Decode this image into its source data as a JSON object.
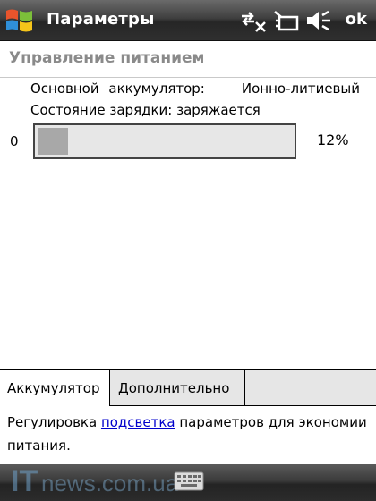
{
  "titlebar": {
    "title": "Параметры",
    "ok_label": "ok",
    "icons": [
      "windows-start-icon",
      "connectivity-icon",
      "charging-icon",
      "volume-icon"
    ]
  },
  "header": {
    "title": "Управление питанием"
  },
  "battery": {
    "main_label": "Основной аккумулятор:",
    "main_value": "Ионно-литиевый",
    "status_text": "Состояние зарядки: заряжается",
    "scale_min": "0",
    "level": 0.12,
    "percent_text": "12%"
  },
  "tabs": [
    {
      "label": "Аккумулятор",
      "selected": true
    },
    {
      "label": "Дополнительно",
      "selected": false
    }
  ],
  "help": {
    "before": "Регулировка ",
    "link": "подсветка",
    "after": " параметров для экономии питания."
  },
  "bottombar": {
    "watermark": "ITnews.com.ua",
    "icon": "keyboard-icon"
  },
  "colors": {
    "bar_fill": "#a8a8a8",
    "bar_track": "#e7e7e7",
    "link": "#0000cc",
    "header_text": "#8a8a8a"
  }
}
